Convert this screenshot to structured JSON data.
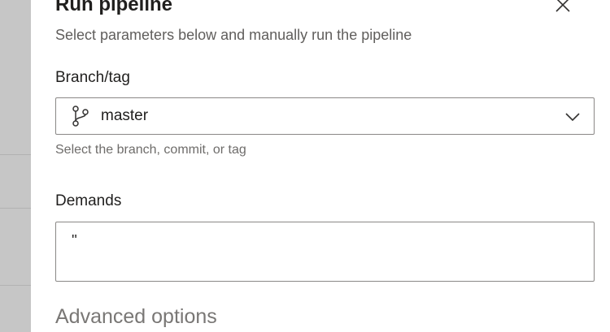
{
  "dialog": {
    "title": "Run pipeline",
    "subtitle": "Select parameters below and manually run the pipeline",
    "close_icon": "close-icon"
  },
  "branch": {
    "label": "Branch/tag",
    "icon": "branch-icon",
    "value": "master",
    "helper": "Select the branch, commit, or tag",
    "chevron_icon": "chevron-down-icon"
  },
  "demands": {
    "label": "Demands",
    "value": "''"
  },
  "advanced": {
    "label": "Advanced options"
  },
  "colors": {
    "text_primary": "#201f1e",
    "text_secondary": "#605e5c",
    "border": "#8a8886",
    "backdrop": "#c6c6c6"
  }
}
